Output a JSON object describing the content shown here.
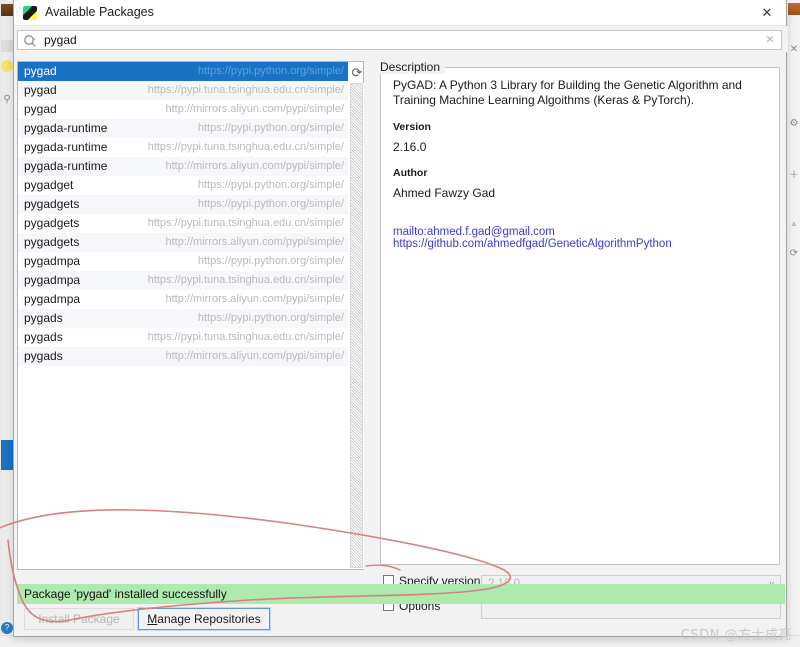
{
  "window": {
    "title": "Available Packages",
    "app_icon": "pycharm-icon",
    "close_label": "✕"
  },
  "search": {
    "value": "pygad",
    "placeholder": "",
    "icon": "search-icon",
    "clear_label": "✕"
  },
  "packages": {
    "refresh_icon": "refresh-icon",
    "selected_index": 0,
    "rows": [
      {
        "name": "pygad",
        "url": "https://pypi.python.org/simple/"
      },
      {
        "name": "pygad",
        "url": "https://pypi.tuna.tsinghua.edu.cn/simple/"
      },
      {
        "name": "pygad",
        "url": "http://mirrors.aliyun.com/pypi/simple/"
      },
      {
        "name": "pygada-runtime",
        "url": "https://pypi.python.org/simple/"
      },
      {
        "name": "pygada-runtime",
        "url": "https://pypi.tuna.tsinghua.edu.cn/simple/"
      },
      {
        "name": "pygada-runtime",
        "url": "http://mirrors.aliyun.com/pypi/simple/"
      },
      {
        "name": "pygadget",
        "url": "https://pypi.python.org/simple/"
      },
      {
        "name": "pygadgets",
        "url": "https://pypi.python.org/simple/"
      },
      {
        "name": "pygadgets",
        "url": "https://pypi.tuna.tsinghua.edu.cn/simple/"
      },
      {
        "name": "pygadgets",
        "url": "http://mirrors.aliyun.com/pypi/simple/"
      },
      {
        "name": "pygadmpa",
        "url": "https://pypi.python.org/simple/"
      },
      {
        "name": "pygadmpa",
        "url": "https://pypi.tuna.tsinghua.edu.cn/simple/"
      },
      {
        "name": "pygadmpa",
        "url": "http://mirrors.aliyun.com/pypi/simple/"
      },
      {
        "name": "pygads",
        "url": "https://pypi.python.org/simple/"
      },
      {
        "name": "pygads",
        "url": "https://pypi.tuna.tsinghua.edu.cn/simple/"
      },
      {
        "name": "pygads",
        "url": "http://mirrors.aliyun.com/pypi/simple/"
      }
    ]
  },
  "description": {
    "legend": "Description",
    "summary": "PyGAD: A Python 3 Library for Building the Genetic Algorithm and Training Machine Learning Algoithms (Keras & PyTorch).",
    "version_label": "Version",
    "version_value": "2.16.0",
    "author_label": "Author",
    "author_value": "Ahmed Fawzy Gad",
    "links": [
      "mailto:ahmed.f.gad@gmail.com",
      "https://github.com/ahmedfgad/GeneticAlgorithmPython"
    ]
  },
  "options": {
    "specify_version_label": "Specify version",
    "specify_version_value": "2.16.0",
    "specify_version_checked": false,
    "options_label": "Options",
    "options_value": "",
    "options_checked": false,
    "chevron": "∨"
  },
  "status": {
    "message": "Package 'pygad' installed successfully",
    "background_color": "#aee9ae"
  },
  "buttons": {
    "install_label": "Install Package",
    "install_enabled": false,
    "manage_prefix": "M",
    "manage_rest": "anage Repositories"
  },
  "watermark": {
    "text": "CSDN @方士成亮"
  },
  "colors": {
    "selection_blue": "#1a72c4",
    "status_green": "#aee9ae",
    "link_purple": "#3b3bc4",
    "annotation_red": "#d98080",
    "focus_blue": "#5b9bd5"
  },
  "background_ide": {
    "right_icons": [
      "close-icon",
      "gear-icon",
      "plus-icon",
      "collapse-icon",
      "refresh-icon"
    ],
    "left_icons": [
      "project-icon",
      "structure-icon",
      "favorites-icon",
      "search-everywhere-icon"
    ]
  }
}
